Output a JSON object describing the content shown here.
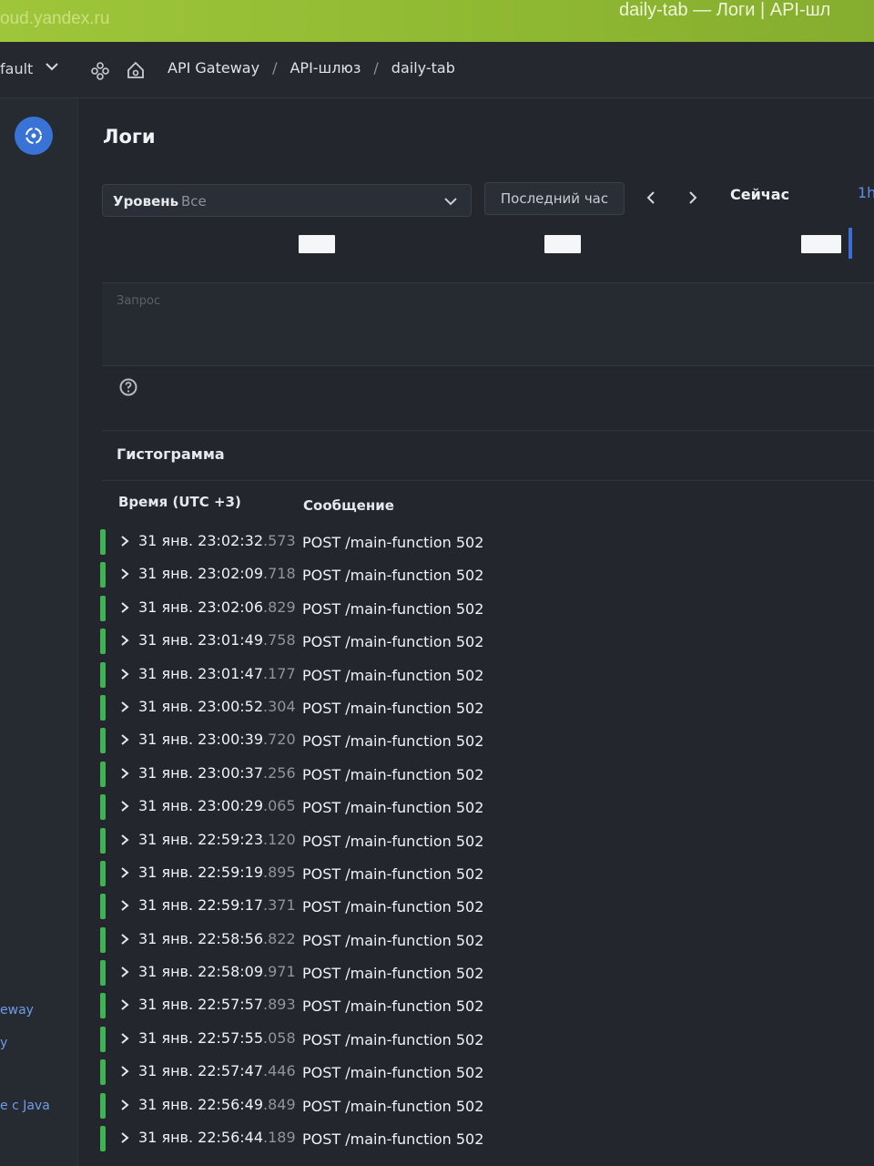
{
  "browser": {
    "url": "oud.yandex.ru",
    "title": "daily-tab — Логи | API-шл"
  },
  "navbar": {
    "folder": "fault",
    "breadcrumbs": [
      "API Gateway",
      "API-шлюз",
      "daily-tab"
    ],
    "separator": "/"
  },
  "sidebar": {
    "labels": [
      "eway",
      "y",
      "e c Java"
    ]
  },
  "main": {
    "title": "Логи",
    "level_label": "Уровень",
    "level_value": "Все",
    "range_label": "Последний час",
    "now_label": "Сейчас",
    "range_short": "1h",
    "query_placeholder": "Запрос",
    "histogram_label": "Гистограмма"
  },
  "table": {
    "col_time": "Время (UTC +3)",
    "col_message": "Сообщение",
    "rows": [
      {
        "time": "31 янв. 23:02:32",
        "ms": ".573",
        "message": "POST /main-function 502"
      },
      {
        "time": "31 янв. 23:02:09",
        "ms": ".718",
        "message": "POST /main-function 502"
      },
      {
        "time": "31 янв. 23:02:06",
        "ms": ".829",
        "message": "POST /main-function 502"
      },
      {
        "time": "31 янв. 23:01:49",
        "ms": ".758",
        "message": "POST /main-function 502"
      },
      {
        "time": "31 янв. 23:01:47",
        "ms": ".177",
        "message": "POST /main-function 502"
      },
      {
        "time": "31 янв. 23:00:52",
        "ms": ".304",
        "message": "POST /main-function 502"
      },
      {
        "time": "31 янв. 23:00:39",
        "ms": ".720",
        "message": "POST /main-function 502"
      },
      {
        "time": "31 янв. 23:00:37",
        "ms": ".256",
        "message": "POST /main-function 502"
      },
      {
        "time": "31 янв. 23:00:29",
        "ms": ".065",
        "message": "POST /main-function 502"
      },
      {
        "time": "31 янв. 22:59:23",
        "ms": ".120",
        "message": "POST /main-function 502"
      },
      {
        "time": "31 янв. 22:59:19",
        "ms": ".895",
        "message": "POST /main-function 502"
      },
      {
        "time": "31 янв. 22:59:17",
        "ms": ".371",
        "message": "POST /main-function 502"
      },
      {
        "time": "31 янв. 22:58:56",
        "ms": ".822",
        "message": "POST /main-function 502"
      },
      {
        "time": "31 янв. 22:58:09",
        "ms": ".971",
        "message": "POST /main-function 502"
      },
      {
        "time": "31 янв. 22:57:57",
        "ms": ".893",
        "message": "POST /main-function 502"
      },
      {
        "time": "31 янв. 22:57:55",
        "ms": ".058",
        "message": "POST /main-function 502"
      },
      {
        "time": "31 янв. 22:57:47",
        "ms": ".446",
        "message": "POST /main-function 502"
      },
      {
        "time": "31 янв. 22:56:49",
        "ms": ".849",
        "message": "POST /main-function 502"
      },
      {
        "time": "31 янв. 22:56:44",
        "ms": ".189",
        "message": "POST /main-function 502"
      }
    ]
  },
  "colors": {
    "accent": "#3a73d6",
    "status_ok": "#3fb34f",
    "browser_bar": "#9fc63a"
  }
}
